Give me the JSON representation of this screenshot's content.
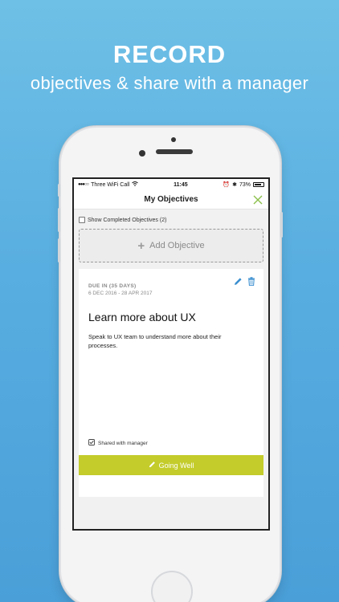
{
  "promo": {
    "headline": "RECORD",
    "subline": "objectives & share with a manager"
  },
  "statusbar": {
    "carrier": "Three WiFi Call",
    "time": "11:45",
    "battery": "73%"
  },
  "navbar": {
    "title": "My Objectives",
    "close_icon": "close-x-icon"
  },
  "filters": {
    "show_completed_label": "Show Completed Objectives (2)",
    "show_completed_checked": false
  },
  "add_objective": {
    "label": "Add Objective"
  },
  "objective": {
    "due_label": "DUE IN (35 DAYS)",
    "date_range": "6 DEC 2016 - 28 APR 2017",
    "title": "Learn more about UX",
    "description": "Speak to UX team to understand more about their processes.",
    "shared_label": "Shared with manager",
    "status_button_label": "Going Well"
  },
  "colors": {
    "background": "#5aafe0",
    "accent_green": "#c3cc2b",
    "icon_blue": "#3a8fd0",
    "close_green": "#8cc04b"
  }
}
